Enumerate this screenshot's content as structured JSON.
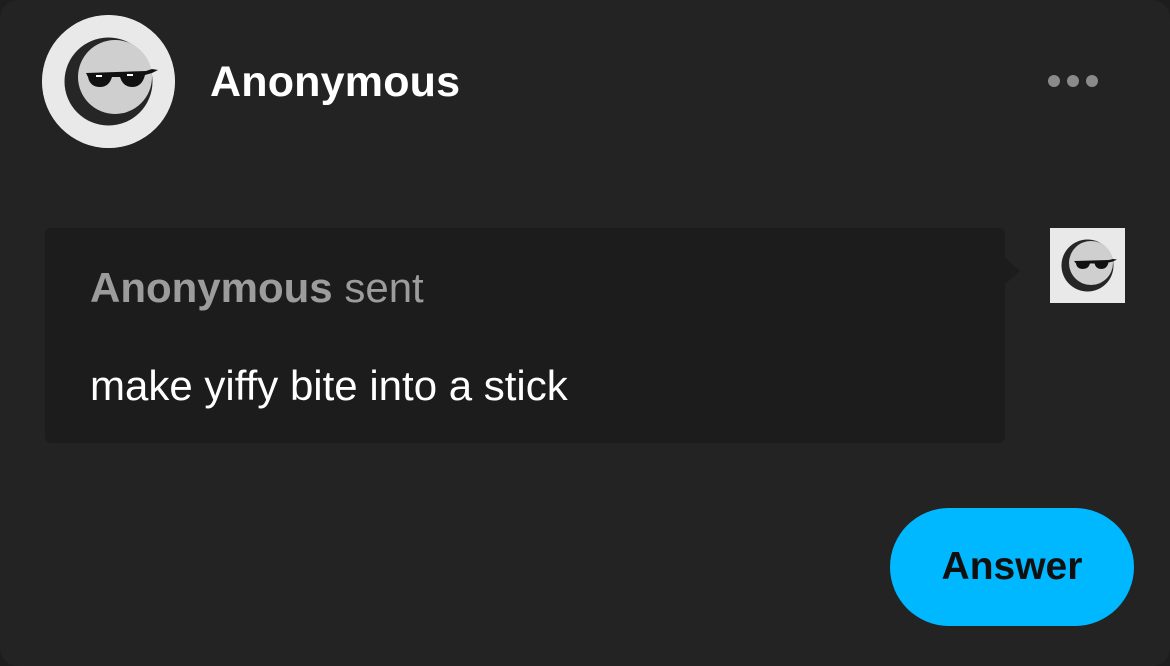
{
  "header": {
    "username": "Anonymous",
    "avatar_icon": "anonymous-sunglasses-icon",
    "more_icon": "more-horizontal-icon"
  },
  "message": {
    "sender_name": "Anonymous",
    "sent_label": "sent",
    "text": "make yiffy bite into a stick",
    "avatar_icon": "anonymous-sunglasses-icon"
  },
  "actions": {
    "answer_label": "Answer"
  },
  "colors": {
    "card_background": "#232323",
    "bubble_background": "#1c1c1c",
    "accent": "#00b8ff",
    "muted_text": "#9c9c9c",
    "primary_text": "#ffffff"
  }
}
